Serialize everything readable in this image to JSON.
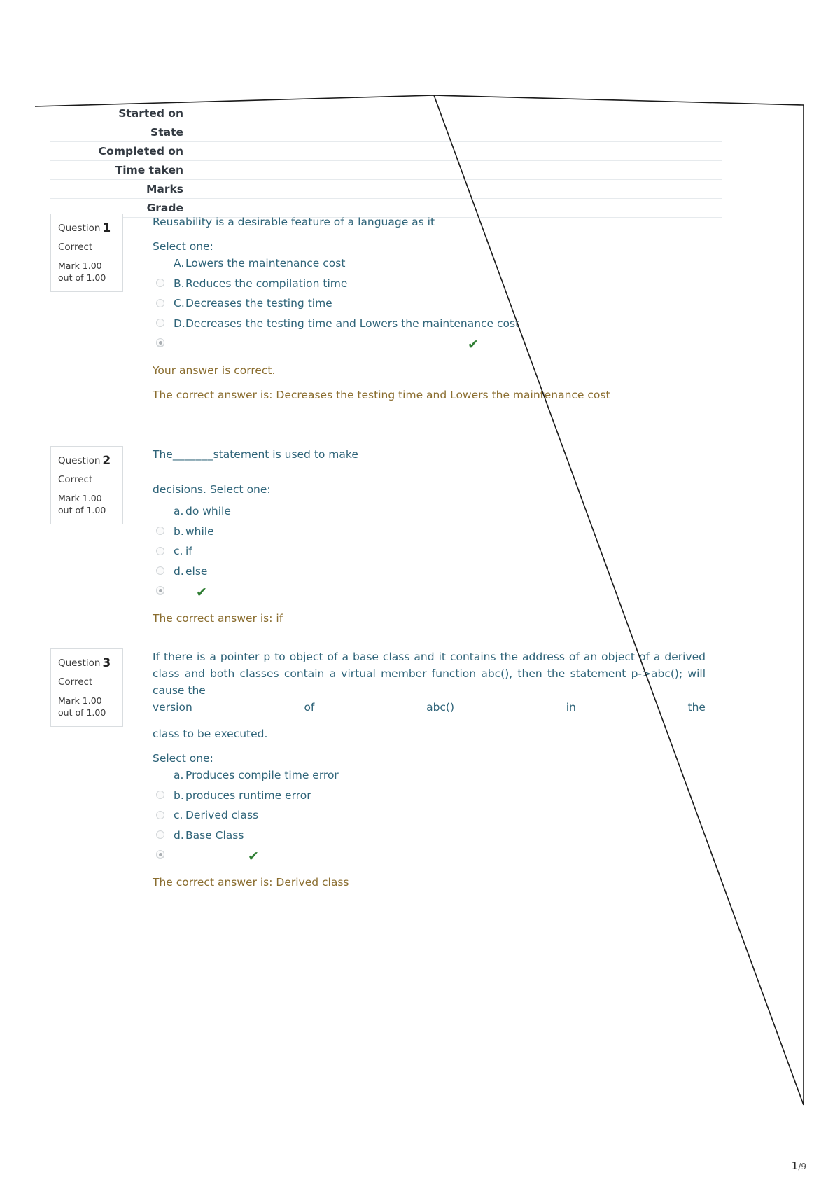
{
  "summary": {
    "rows": [
      {
        "label": "Started on",
        "value": ""
      },
      {
        "label": "State",
        "value": ""
      },
      {
        "label": "Completed on",
        "value": ""
      },
      {
        "label": "Time taken",
        "value": ""
      },
      {
        "label": "Marks",
        "value": ""
      },
      {
        "label": "Grade",
        "value": ""
      }
    ]
  },
  "questions": [
    {
      "info": {
        "question_word": "Question",
        "number": "1",
        "state": "Correct",
        "mark": "Mark 1.00 out of 1.00"
      },
      "stem": "Reusability is a desirable feature of a language as it",
      "select_one": "Select one:",
      "options": [
        {
          "letter": "A.",
          "text": "Lowers the maintenance cost",
          "checked": false
        },
        {
          "letter": "B.",
          "text": "Reduces the compilation time",
          "checked": false
        },
        {
          "letter": "C.",
          "text": "Decreases the testing time",
          "checked": false
        },
        {
          "letter": "D.",
          "text": "Decreases the testing time and Lowers the maintenance cost",
          "checked": false
        }
      ],
      "selected_marker": true,
      "tick": "✔",
      "feedback_result": "Your answer is correct.",
      "feedback_answer": "The correct answer is: Decreases the testing time and Lowers the maintenance cost"
    },
    {
      "info": {
        "question_word": "Question",
        "number": "2",
        "state": "Correct",
        "mark": "Mark 1.00 out of 1.00"
      },
      "stem_prefix": "The",
      "stem_blank": "_______",
      "stem_suffix": "statement is used to make",
      "stem_second_line": "decisions. Select one:",
      "options": [
        {
          "letter": "a.",
          "text": "do while",
          "checked": false
        },
        {
          "letter": "b.",
          "text": "while",
          "checked": false
        },
        {
          "letter": "c.",
          "text": "if",
          "checked": false
        },
        {
          "letter": "d.",
          "text": "else",
          "checked": false
        }
      ],
      "selected_marker": true,
      "tick": "✔",
      "feedback_answer": "The correct answer is: if"
    },
    {
      "info": {
        "question_word": "Question",
        "number": "3",
        "state": "Correct",
        "mark": "Mark 1.00 out of 1.00"
      },
      "stem_line1": "If there is a pointer p to object of a base class and it contains the address of an object of a derived class and both classes contain a virtual member function abc(), then the statement p->abc(); will cause the",
      "stem_line2_words": [
        "version",
        "of",
        "abc()",
        "in",
        "the"
      ],
      "stem_line3": "class to be executed.",
      "select_one": "Select one:",
      "options": [
        {
          "letter": "a.",
          "text": "Produces compile time error",
          "checked": false
        },
        {
          "letter": "b.",
          "text": "produces runtime error",
          "checked": false
        },
        {
          "letter": "c.",
          "text": "Derived class",
          "checked": false
        },
        {
          "letter": "d.",
          "text": "Base Class",
          "checked": false
        }
      ],
      "selected_marker": true,
      "tick": "✔",
      "feedback_answer": "The correct answer is: Derived class"
    }
  ],
  "footer": {
    "page_current": "1",
    "page_separator": "/",
    "page_total": "9"
  },
  "colors": {
    "question_text": "#2f6479",
    "feedback_text": "#8a6d2f",
    "tick_green": "#2e7d32",
    "label_dark": "#333a42"
  }
}
